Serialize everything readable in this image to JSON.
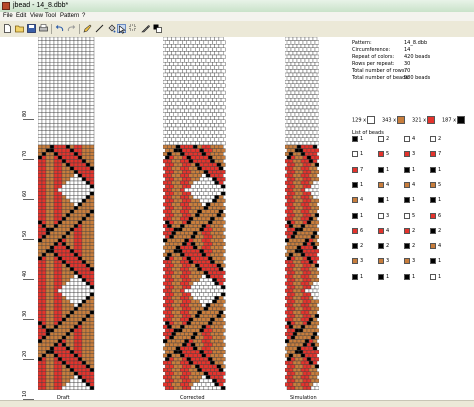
{
  "window": {
    "title": "jbead - 14_8.dbb*"
  },
  "menu": [
    "File",
    "Edit",
    "View",
    "Tool",
    "Pattern",
    "?"
  ],
  "toolbar": {
    "icons": [
      "new-file-icon",
      "open-file-icon",
      "save-file-icon",
      "print-icon",
      "undo-icon",
      "redo-icon",
      "pencil-icon",
      "select-icon",
      "line-icon",
      "fill-icon",
      "pipette-icon",
      "swap-icon"
    ]
  },
  "palette": {
    "colors": [
      "#ffffff",
      "#000000",
      "#e4332c",
      "#c87d3c",
      "#f6e05a",
      "#9ad34c",
      "#2c8c3c",
      "#3c6cd4",
      "#1c2c8c",
      "#c84cc8",
      "#7c3c1c",
      "#bcbcbc",
      "#5c5c5c",
      "#f08cb4",
      "#8cd4f0",
      "#fcfcfc",
      "#ffd8a8",
      "#a8ffd8",
      "#d8a8ff",
      "#a8d8ff",
      "#ffa8a8",
      "#ffffa8",
      "#e0e0e0",
      "#404040"
    ]
  },
  "views": {
    "draft_label": "Draft",
    "corrected_label": "Corrected",
    "simulation_label": "Simulation",
    "ruler": [
      "80",
      "70",
      "60",
      "50",
      "40",
      "30",
      "20",
      "10"
    ]
  },
  "info": {
    "pattern_label": "Pattern:",
    "pattern_value": "14_8.dbb",
    "circumference_label": "Circumference:",
    "circumference_value": "14",
    "repeat_label": "Repeat of colors:",
    "repeat_value": "420 beads",
    "rows_repeat_label": "Rows per repeat:",
    "rows_repeat_value": "30",
    "rows_total_label": "Total number of rows:",
    "rows_total_value": "70",
    "beads_total_label": "Total number of beads:",
    "beads_total_value": "980 beads"
  },
  "counts": [
    {
      "count": "129 x",
      "color": "#ffffff"
    },
    {
      "count": "343 x",
      "color": "#c87d3c"
    },
    {
      "count": "321 x",
      "color": "#e4332c"
    },
    {
      "count": "187 x",
      "color": "#000000"
    }
  ],
  "list_header": "List of beads",
  "bead_list": [
    {
      "color": "#000000",
      "count": "1"
    },
    {
      "color": "#ffffff",
      "count": "1"
    },
    {
      "color": "#e4332c",
      "count": "7"
    },
    {
      "color": "#000000",
      "count": "1"
    },
    {
      "color": "#c87d3c",
      "count": "4"
    },
    {
      "color": "#000000",
      "count": "1"
    },
    {
      "color": "#e4332c",
      "count": "6"
    },
    {
      "color": "#000000",
      "count": "2"
    },
    {
      "color": "#c87d3c",
      "count": "3"
    },
    {
      "color": "#000000",
      "count": "1"
    },
    {
      "color": "#ffffff",
      "count": "2"
    },
    {
      "color": "#e4332c",
      "count": "5"
    },
    {
      "color": "#000000",
      "count": "1"
    },
    {
      "color": "#c87d3c",
      "count": "4"
    },
    {
      "color": "#000000",
      "count": "1"
    },
    {
      "color": "#ffffff",
      "count": "3"
    },
    {
      "color": "#e4332c",
      "count": "4"
    },
    {
      "color": "#000000",
      "count": "2"
    },
    {
      "color": "#c87d3c",
      "count": "3"
    },
    {
      "color": "#000000",
      "count": "1"
    },
    {
      "color": "#ffffff",
      "count": "4"
    },
    {
      "color": "#e4332c",
      "count": "3"
    },
    {
      "color": "#000000",
      "count": "1"
    },
    {
      "color": "#c87d3c",
      "count": "4"
    },
    {
      "color": "#000000",
      "count": "1"
    },
    {
      "color": "#ffffff",
      "count": "5"
    },
    {
      "color": "#e4332c",
      "count": "2"
    },
    {
      "color": "#000000",
      "count": "2"
    },
    {
      "color": "#c87d3c",
      "count": "3"
    },
    {
      "color": "#000000",
      "count": "1"
    },
    {
      "color": "#ffffff",
      "count": "2"
    },
    {
      "color": "#e4332c",
      "count": "7"
    },
    {
      "color": "#000000",
      "count": "1"
    },
    {
      "color": "#c87d3c",
      "count": "5"
    },
    {
      "color": "#000000",
      "count": "1"
    },
    {
      "color": "#e4332c",
      "count": "6"
    },
    {
      "color": "#000000",
      "count": "2"
    },
    {
      "color": "#c87d3c",
      "count": "4"
    },
    {
      "color": "#000000",
      "count": "1"
    },
    {
      "color": "#ffffff",
      "count": "1"
    }
  ]
}
